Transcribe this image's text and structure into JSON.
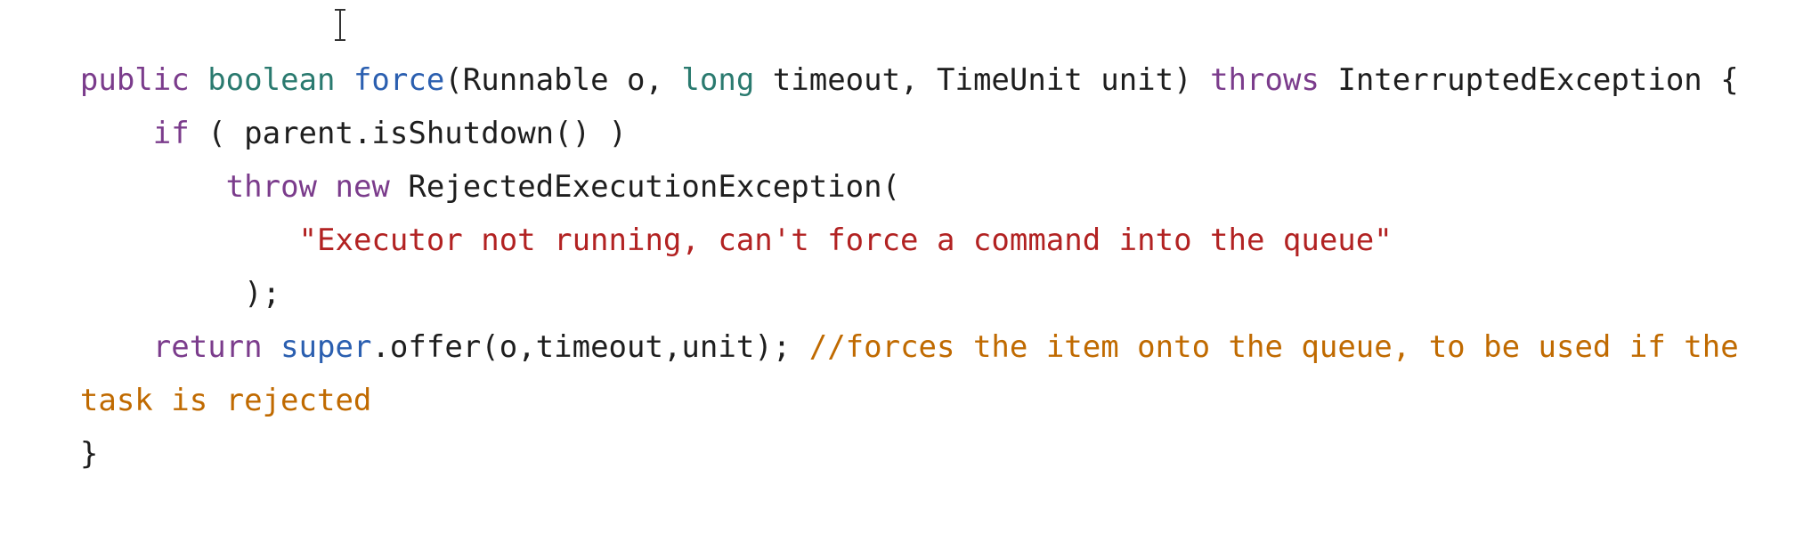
{
  "editor": {
    "lines": [
      {
        "tokens": [
          {
            "text": "public ",
            "kind": "kw-purple"
          },
          {
            "text": "boolean ",
            "kind": "kw-teal"
          },
          {
            "text": "force",
            "kind": "kw-blue"
          },
          {
            "text": "(Runnable o, ",
            "kind": "plain"
          },
          {
            "text": "long ",
            "kind": "kw-teal"
          },
          {
            "text": "timeout, TimeUnit unit) ",
            "kind": "plain"
          },
          {
            "text": "throws ",
            "kind": "kw-purple"
          },
          {
            "text": "InterruptedException {",
            "kind": "plain"
          }
        ]
      },
      {
        "tokens": [
          {
            "text": "    ",
            "kind": "plain"
          },
          {
            "text": "if",
            "kind": "kw-purple"
          },
          {
            "text": " ( parent.isShutdown() )",
            "kind": "plain"
          }
        ]
      },
      {
        "tokens": [
          {
            "text": "        ",
            "kind": "plain"
          },
          {
            "text": "throw ",
            "kind": "kw-purple"
          },
          {
            "text": "new ",
            "kind": "kw-purple"
          },
          {
            "text": "RejectedExecutionException(",
            "kind": "plain"
          }
        ]
      },
      {
        "tokens": [
          {
            "text": "            ",
            "kind": "plain"
          },
          {
            "text": "\"Executor not running, can't force a command into the queue\"",
            "kind": "string"
          }
        ]
      },
      {
        "tokens": [
          {
            "text": "         );",
            "kind": "plain"
          }
        ]
      },
      {
        "tokens": [
          {
            "text": "    ",
            "kind": "plain"
          },
          {
            "text": "return ",
            "kind": "kw-purple"
          },
          {
            "text": "super",
            "kind": "kw-blue"
          },
          {
            "text": ".offer(o,timeout,unit); ",
            "kind": "plain"
          },
          {
            "text": "//forces the item onto the queue, to be used if the",
            "kind": "comment"
          }
        ]
      },
      {
        "tokens": [
          {
            "text": "task is rejected",
            "kind": "comment"
          }
        ]
      },
      {
        "tokens": [
          {
            "text": "}",
            "kind": "plain"
          }
        ]
      }
    ]
  }
}
